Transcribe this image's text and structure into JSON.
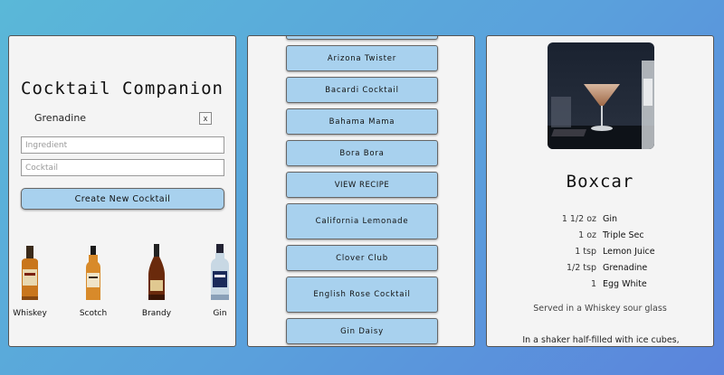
{
  "app": {
    "title": "Cocktail Companion"
  },
  "filters": {
    "selected_ingredient": "Grenadine",
    "remove_label": "x",
    "ingredient_placeholder": "Ingredient",
    "cocktail_placeholder": "Cocktail",
    "create_button_label": "Create New Cocktail"
  },
  "spirits": [
    {
      "name": "Whiskey",
      "icon": "whiskey-bottle-icon"
    },
    {
      "name": "Scotch",
      "icon": "scotch-bottle-icon"
    },
    {
      "name": "Brandy",
      "icon": "brandy-bottle-icon"
    },
    {
      "name": "Gin",
      "icon": "gin-bottle-icon"
    }
  ],
  "recipes": [
    "",
    "Arizona Twister",
    "Bacardi Cocktail",
    "Bahama Mama",
    "Bora Bora",
    "VIEW RECIPE",
    "California Lemonade",
    "Clover Club",
    "English Rose Cocktail",
    "Gin Daisy"
  ],
  "detail": {
    "name": "Boxcar",
    "ingredients": [
      {
        "qty": "1 1/2 oz",
        "name": "Gin"
      },
      {
        "qty": "1 oz",
        "name": "Triple Sec"
      },
      {
        "qty": "1 tsp",
        "name": "Lemon Juice"
      },
      {
        "qty": "1/2 tsp",
        "name": "Grenadine"
      },
      {
        "qty": "1",
        "name": "Egg White"
      }
    ],
    "glass": "Served in a Whiskey sour glass",
    "method": "In a shaker half-filled with ice cubes,"
  },
  "colors": {
    "button_fill": "#a8d1ee",
    "panel_bg": "#f4f4f4"
  }
}
